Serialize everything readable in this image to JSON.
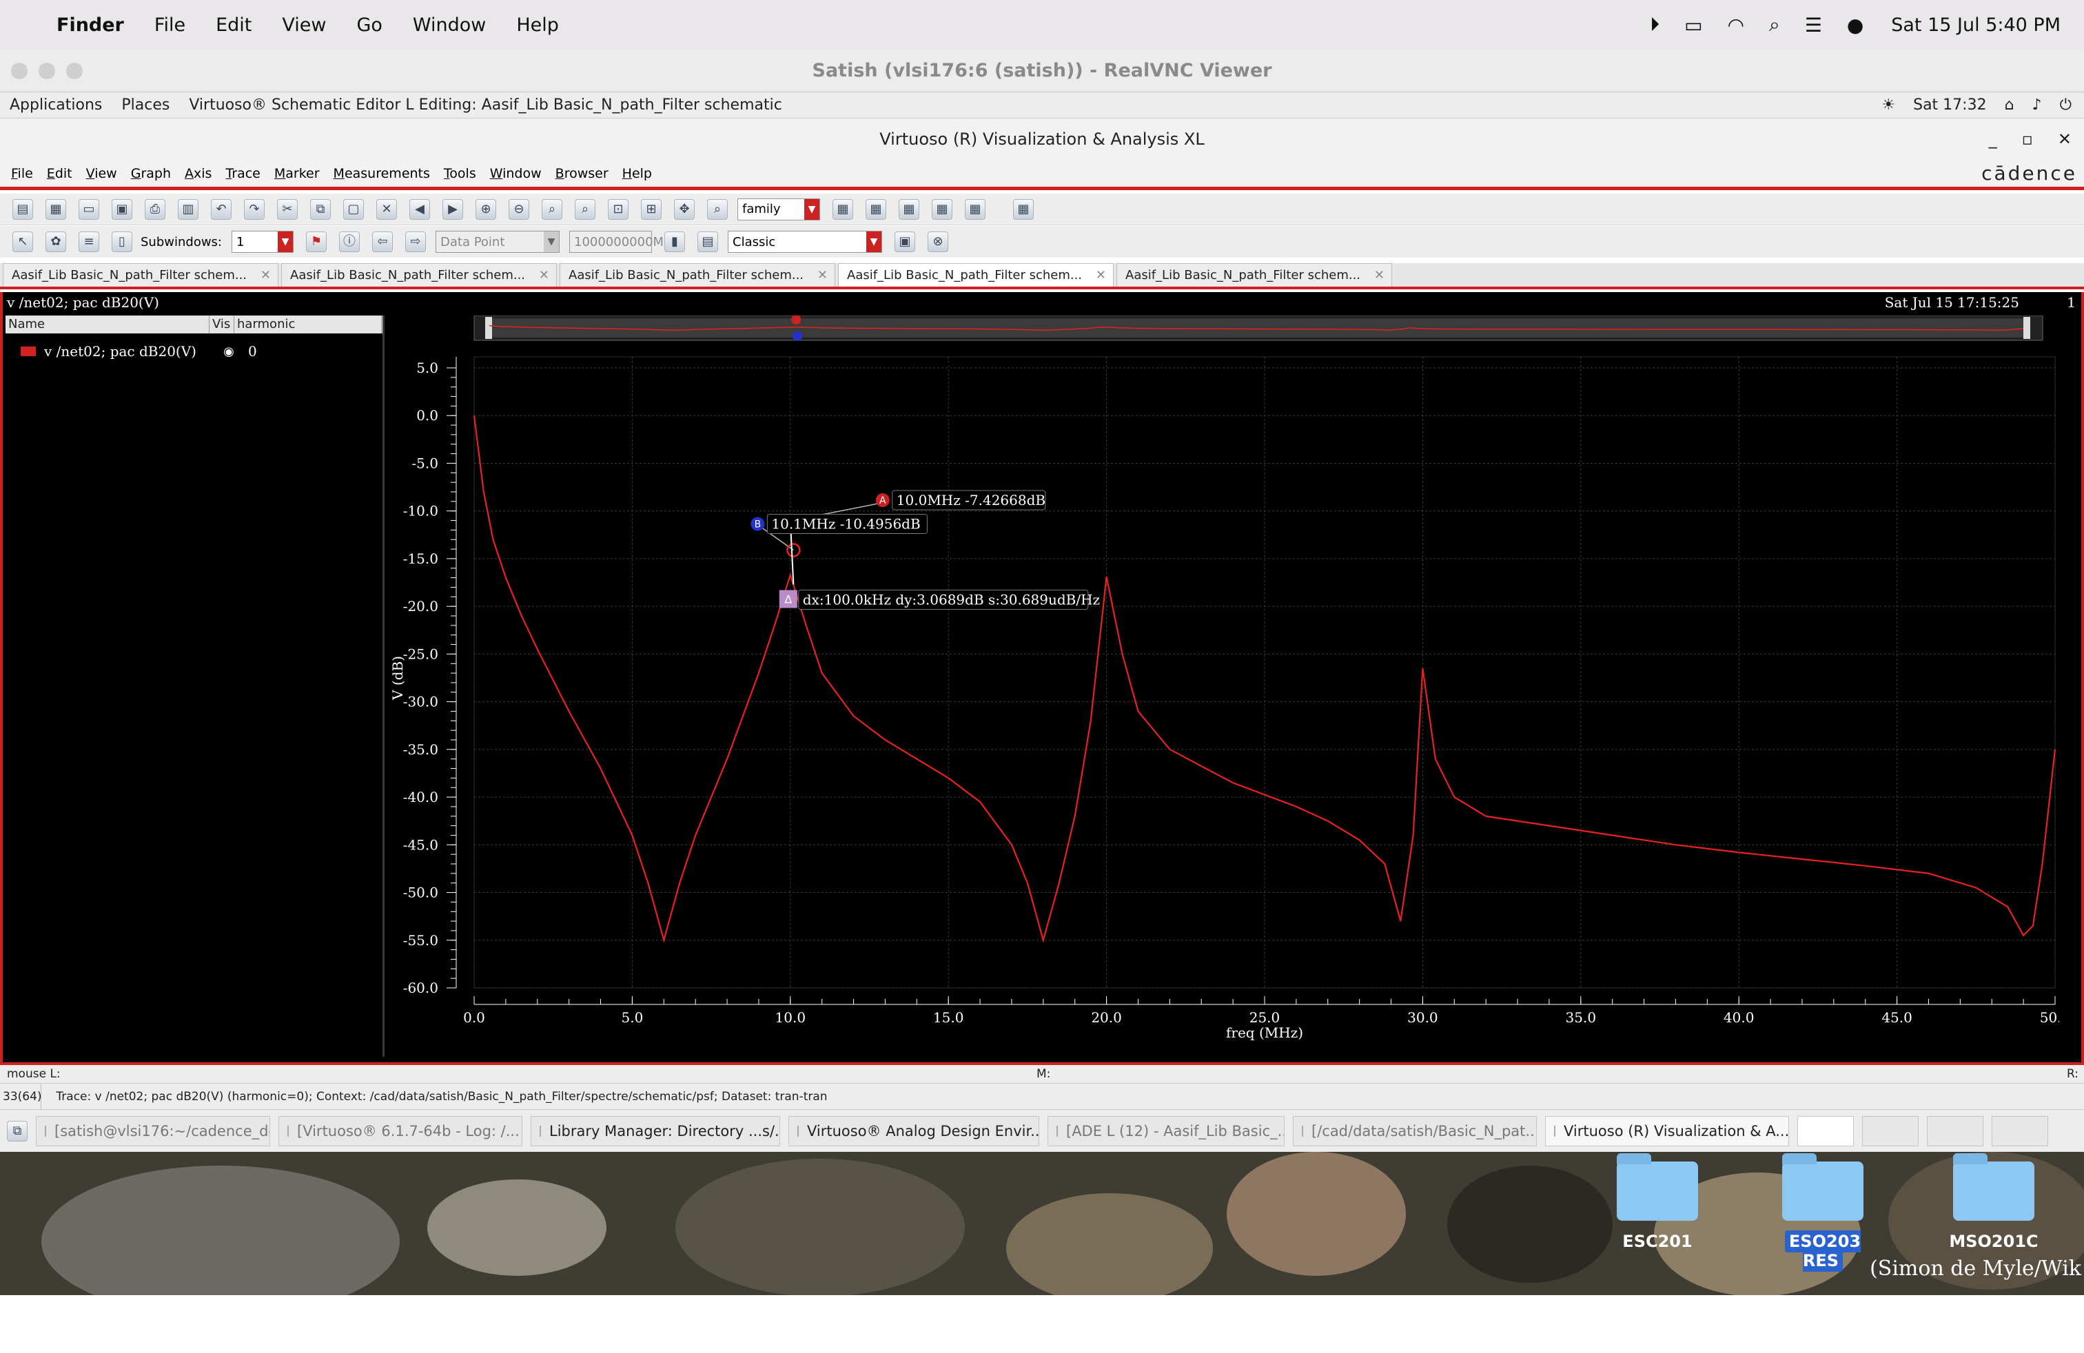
{
  "mac": {
    "app": "Finder",
    "menus": [
      "File",
      "Edit",
      "View",
      "Go",
      "Window",
      "Help"
    ],
    "clock": "Sat 15 Jul  5:40 PM"
  },
  "vnc": {
    "title": "Satish (vlsi176:6 (satish)) - RealVNC Viewer"
  },
  "gnome": {
    "applications": "Applications",
    "places": "Places",
    "window_label": "Virtuoso® Schematic Editor L Editing: Aasif_Lib Basic_N_path_Filter schematic",
    "time": "Sat 17:32"
  },
  "virtuoso": {
    "title": "Virtuoso (R) Visualization & Analysis XL",
    "brand": "cādence",
    "menus": [
      "File",
      "Edit",
      "View",
      "Graph",
      "Axis",
      "Trace",
      "Marker",
      "Measurements",
      "Tools",
      "Window",
      "Browser",
      "Help"
    ],
    "toolbar": {
      "family_combo": "family",
      "subwindows_label": "Subwindows:",
      "subwindows_value": "1",
      "data_point_combo": "Data Point",
      "value_field": "1000000000M",
      "style_combo": "Classic"
    },
    "tabs": [
      "Aasif_Lib Basic_N_path_Filter schem...",
      "Aasif_Lib Basic_N_path_Filter schem...",
      "Aasif_Lib Basic_N_path_Filter schem...",
      "Aasif_Lib Basic_N_path_Filter schem...",
      "Aasif_Lib Basic_N_path_Filter schem..."
    ],
    "plot_header": "v /net02; pac dB20(V)",
    "timestamp": "Sat Jul 15 17:15:25",
    "subwindow_no": "1",
    "trace_panel": {
      "col_name": "Name",
      "col_vis": "Vis",
      "col_harmonic": "harmonic",
      "trace_name": "v /net02; pac dB20(V)",
      "trace_harmonic": "0",
      "trace_color": "#d0231f"
    },
    "status": {
      "mouse_l": "mouse L:",
      "mouse_m": "M:",
      "mouse_r": "R:",
      "line_no": "33(64)",
      "message": "Trace: v /net02; pac dB20(V) (harmonic=0); Context: /cad/data/satish/Basic_N_path_Filter/spectre/schematic/psf; Dataset: tran-tran"
    }
  },
  "chart_data": {
    "type": "line",
    "xlabel": "freq (MHz)",
    "ylabel": "V (dB)",
    "xlim": [
      0,
      50
    ],
    "ylim": [
      -60,
      5
    ],
    "x_ticks": [
      "0.0",
      "5.0",
      "10.0",
      "15.0",
      "20.0",
      "25.0",
      "30.0",
      "35.0",
      "40.0",
      "45.0",
      "50.0"
    ],
    "y_ticks": [
      "5.0",
      "0.0",
      "-5.0",
      "-10.0",
      "-15.0",
      "-20.0",
      "-25.0",
      "-30.0",
      "-35.0",
      "-40.0",
      "-45.0",
      "-50.0",
      "-55.0",
      "-60.0"
    ],
    "series": [
      {
        "color": "#e8231e",
        "x": [
          0.0,
          0.3,
          0.6,
          1.0,
          1.5,
          2.0,
          3.0,
          4.0,
          5.0,
          5.5,
          6.0,
          6.5,
          7.0,
          8.0,
          9.0,
          9.5,
          10.0,
          10.5,
          11.0,
          12.0,
          13.0,
          14.0,
          15.0,
          16.0,
          17.0,
          17.5,
          18.0,
          18.5,
          19.0,
          19.5,
          20.0,
          20.5,
          21.0,
          22.0,
          24.0,
          26.0,
          27.0,
          28.0,
          28.8,
          29.3,
          29.7,
          30.0,
          30.4,
          31.0,
          32.0,
          34.0,
          36.0,
          38.0,
          40.0,
          42.0,
          44.0,
          46.0,
          47.5,
          48.5,
          49.0,
          49.3,
          49.6,
          49.8,
          50.0
        ],
        "y": [
          0.0,
          -8.0,
          -13.0,
          -17.0,
          -21.0,
          -24.5,
          -31.0,
          -37.0,
          -44.0,
          -49.0,
          -55.0,
          -49.0,
          -44.0,
          -36.0,
          -27.0,
          -22.0,
          -16.7,
          -22.0,
          -27.0,
          -31.5,
          -34.0,
          -36.0,
          -38.0,
          -40.5,
          -45.0,
          -49.0,
          -55.0,
          -49.0,
          -42.0,
          -32.0,
          -16.9,
          -25.0,
          -31.0,
          -35.0,
          -38.5,
          -41.0,
          -42.5,
          -44.5,
          -47.0,
          -53.0,
          -44.0,
          -26.5,
          -36.0,
          -40.0,
          -42.0,
          -43.0,
          -44.0,
          -45.0,
          -45.8,
          -46.5,
          -47.2,
          -48.0,
          -49.5,
          -51.5,
          -54.5,
          -53.5,
          -47.0,
          -41.0,
          -35.0
        ]
      }
    ],
    "markers": [
      {
        "id": "A",
        "x": 10.0,
        "y": -7.42668,
        "label": "10.0MHz -7.42668dB"
      },
      {
        "id": "B",
        "x": 10.1,
        "y": -10.4956,
        "label": "10.1MHz -10.4956dB"
      }
    ],
    "delta_label": "dx:100.0kHz dy:3.0689dB s:30.689udB/Hz"
  },
  "taskbar": [
    "[satish@vlsi176:~/cadence_de...",
    "[Virtuoso® 6.1.7-64b - Log: /...",
    "Library Manager: Directory ...s/...",
    "Virtuoso® Analog Design Envir...",
    "[ADE L (12) - Aasif_Lib Basic_...",
    "[/cad/data/satish/Basic_N_pat...",
    "Virtuoso (R) Visualization & A..."
  ],
  "desktop": {
    "folders": [
      "ESC201",
      "ESO203 RES",
      "MSO201C"
    ],
    "credit": "(Simon de Myle/Wik"
  }
}
